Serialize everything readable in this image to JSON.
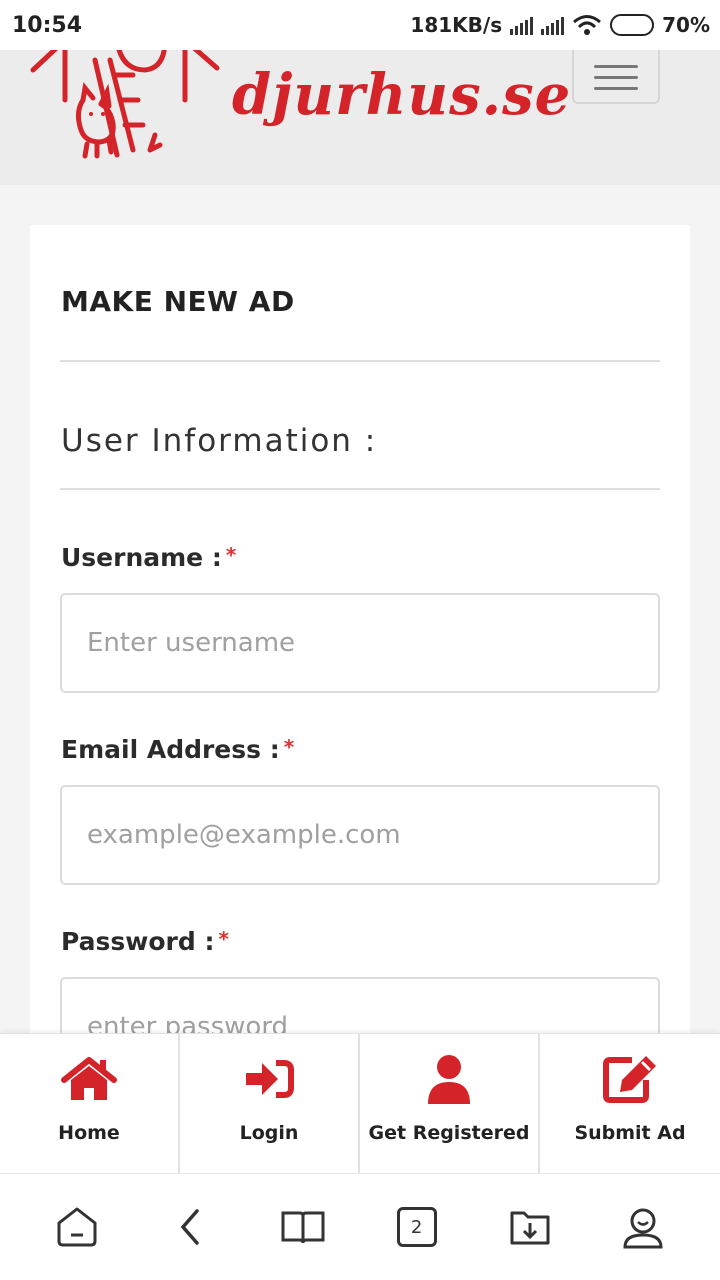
{
  "status_bar": {
    "time": "10:54",
    "speed": "181KB/s",
    "battery": "70%"
  },
  "header": {
    "brand": "djurhus.se",
    "brand_color": "#d42429",
    "menu_icon": "hamburger-icon"
  },
  "form": {
    "title": "MAKE NEW AD",
    "section_title": "User Information :",
    "fields": [
      {
        "label": "Username :",
        "required": "*",
        "placeholder": "Enter username",
        "value": ""
      },
      {
        "label": "Email Address :",
        "required": "*",
        "placeholder": "example@example.com",
        "value": ""
      },
      {
        "label": "Password :",
        "required": "*",
        "placeholder": "enter password",
        "value": ""
      }
    ]
  },
  "tab_nav": [
    {
      "label": "Home",
      "icon": "home-icon"
    },
    {
      "label": "Login",
      "icon": "login-icon"
    },
    {
      "label": "Get Registered",
      "icon": "user-icon"
    },
    {
      "label": "Submit Ad",
      "icon": "edit-icon"
    }
  ],
  "browser_bar": {
    "tab_count": "2",
    "icons": [
      "home-icon",
      "back-icon",
      "bookmarks-icon",
      "tabs-icon",
      "downloads-icon",
      "profile-icon"
    ]
  },
  "colors": {
    "accent": "#d42429",
    "required": "#e03030"
  }
}
